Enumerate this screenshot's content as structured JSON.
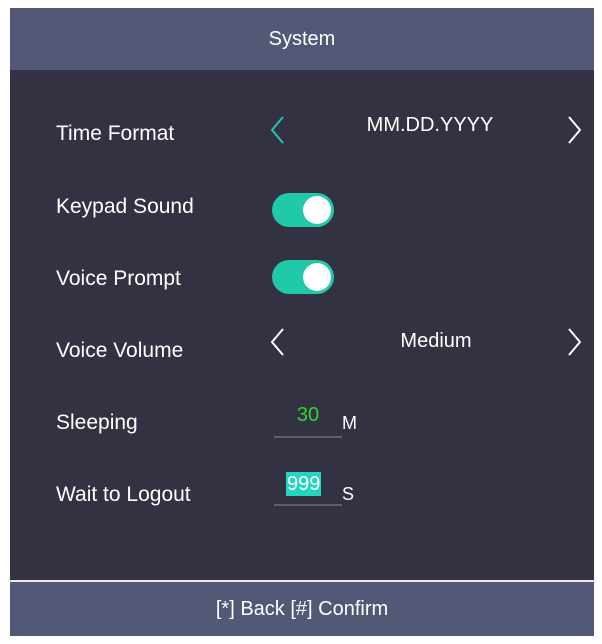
{
  "header": {
    "title": "System"
  },
  "settings": {
    "time_format": {
      "label": "Time Format",
      "value": "MM.DD.YYYY"
    },
    "keypad_sound": {
      "label": "Keypad Sound",
      "enabled": true
    },
    "voice_prompt": {
      "label": "Voice Prompt",
      "enabled": true
    },
    "voice_volume": {
      "label": "Voice Volume",
      "value": "Medium"
    },
    "sleeping": {
      "label": "Sleeping",
      "value": "30",
      "unit": "M"
    },
    "wait_to_logout": {
      "label": "Wait to Logout",
      "value": "999",
      "unit": "S"
    }
  },
  "footer": {
    "hint": "[*] Back [#] Confirm"
  },
  "colors": {
    "accent": "#20c9a8",
    "background": "#333242",
    "bar": "#535876",
    "sleep_value": "#2fd42f",
    "selection": "#22d6c2"
  },
  "icons": {
    "prev": "chevron-left-icon",
    "next": "chevron-right-icon"
  }
}
